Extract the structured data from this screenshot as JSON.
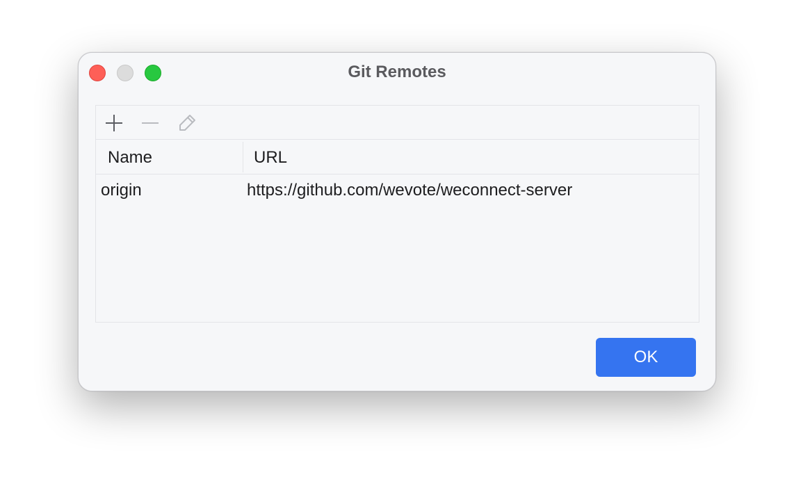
{
  "window": {
    "title": "Git Remotes"
  },
  "toolbar": {
    "add_icon": "plus-icon",
    "remove_icon": "minus-icon",
    "edit_icon": "pencil-icon"
  },
  "table": {
    "columns": [
      "Name",
      "URL"
    ],
    "rows": [
      {
        "name": "origin",
        "url": "https://github.com/wevote/weconnect-server"
      }
    ]
  },
  "buttons": {
    "ok_label": "OK"
  },
  "colors": {
    "accent": "#3574f0",
    "close": "#fe5f57",
    "zoom": "#28c840",
    "minimize": "#dcdcdc"
  }
}
